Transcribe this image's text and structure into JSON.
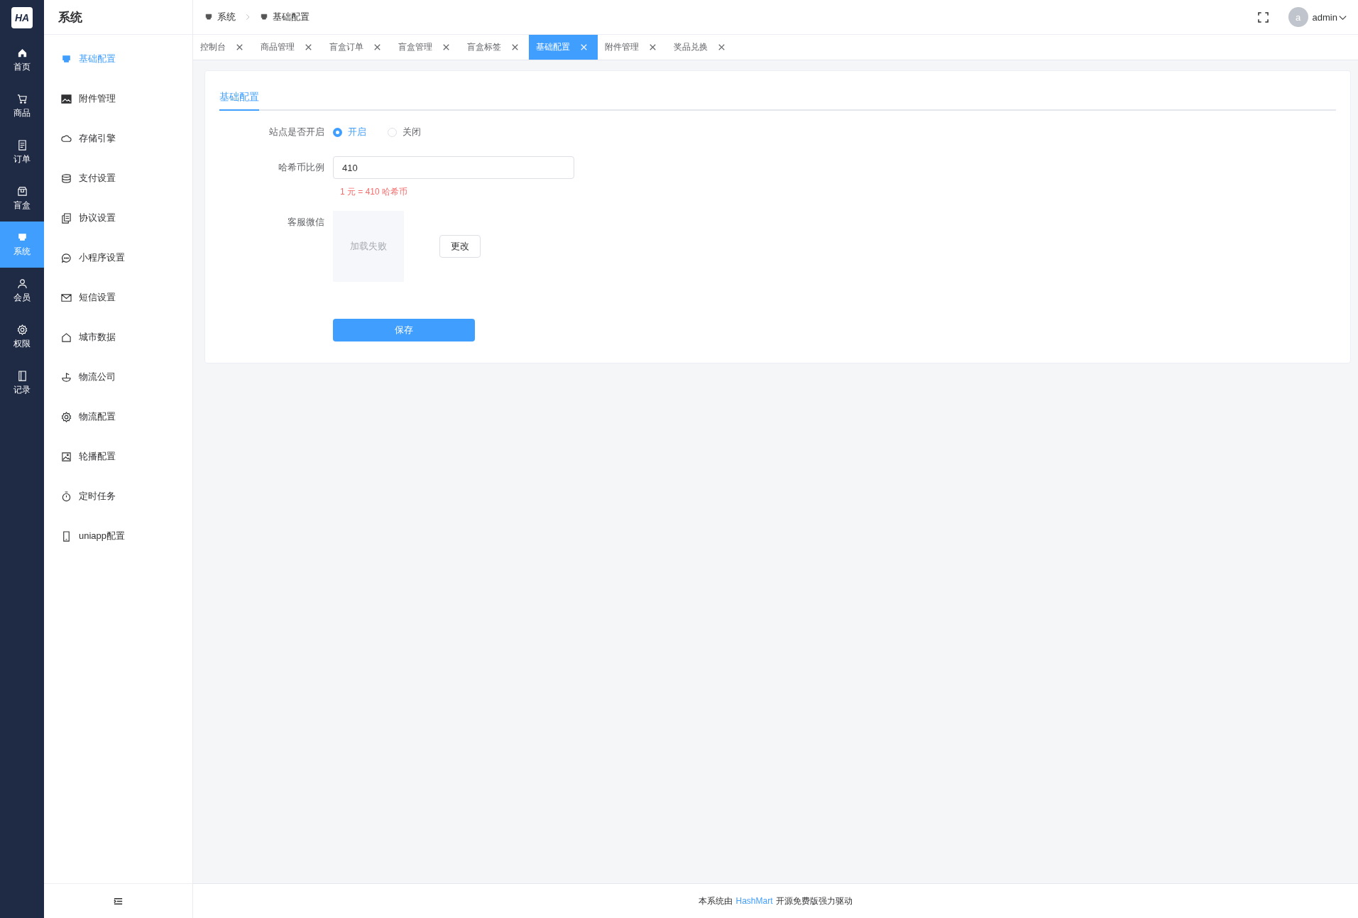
{
  "rail": {
    "logo": "HA",
    "items": [
      {
        "label": "首页",
        "selected": false
      },
      {
        "label": "商品",
        "selected": false
      },
      {
        "label": "订单",
        "selected": false
      },
      {
        "label": "盲盒",
        "selected": false
      },
      {
        "label": "系统",
        "selected": true
      },
      {
        "label": "会员",
        "selected": false
      },
      {
        "label": "权限",
        "selected": false
      },
      {
        "label": "记录",
        "selected": false
      }
    ]
  },
  "submenu": {
    "title": "系统",
    "items": [
      {
        "label": "基础配置",
        "selected": true
      },
      {
        "label": "附件管理",
        "selected": false
      },
      {
        "label": "存储引擎",
        "selected": false
      },
      {
        "label": "支付设置",
        "selected": false
      },
      {
        "label": "协议设置",
        "selected": false
      },
      {
        "label": "小程序设置",
        "selected": false
      },
      {
        "label": "短信设置",
        "selected": false
      },
      {
        "label": "城市数据",
        "selected": false
      },
      {
        "label": "物流公司",
        "selected": false
      },
      {
        "label": "物流配置",
        "selected": false
      },
      {
        "label": "轮播配置",
        "selected": false
      },
      {
        "label": "定时任务",
        "selected": false
      },
      {
        "label": "uniapp配置",
        "selected": false
      }
    ]
  },
  "breadcrumb": [
    "系统",
    "基础配置"
  ],
  "user": {
    "avatar": "a",
    "name": "admin"
  },
  "tabs": [
    {
      "label": "控制台",
      "selected": false
    },
    {
      "label": "商品管理",
      "selected": false
    },
    {
      "label": "盲盒订单",
      "selected": false
    },
    {
      "label": "盲盒管理",
      "selected": false
    },
    {
      "label": "盲盒标签",
      "selected": false
    },
    {
      "label": "基础配置",
      "selected": true
    },
    {
      "label": "附件管理",
      "selected": false
    },
    {
      "label": "奖品兑换",
      "selected": false
    }
  ],
  "panel": {
    "tabs": [
      {
        "label": "基础配置",
        "selected": true
      }
    ],
    "fields": [
      {
        "kind": "radio",
        "label": "站点是否开启",
        "options": [
          {
            "label": "开启",
            "selected": true
          },
          {
            "label": "关闭",
            "selected": false
          }
        ]
      },
      {
        "kind": "input",
        "label": "哈希币比例",
        "value": "410",
        "hint": "1 元 = 410 哈希币"
      },
      {
        "kind": "image",
        "label": "客服微信",
        "image_text": "加载失败",
        "button": "更改"
      }
    ],
    "save": "保存"
  },
  "footer": {
    "before": "本系统由",
    "link": "HashMart",
    "after": "开源免费版强力驱动"
  }
}
